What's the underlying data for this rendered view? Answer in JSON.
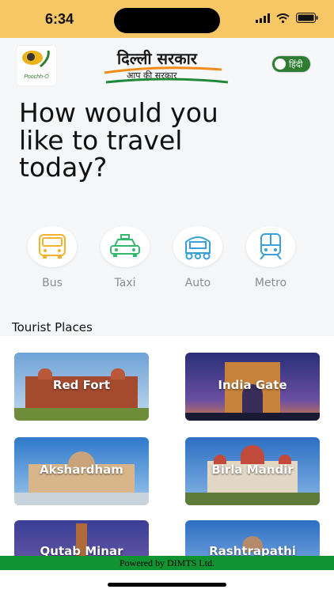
{
  "status_bar": {
    "time": "6:34"
  },
  "header": {
    "logo_caption": "Poochh-O",
    "govt_title": "दिल्ली सरकार",
    "govt_subtitle": "आप की सरकार",
    "language_toggle_label": "हिंदी"
  },
  "heading": "How would you like to travel today?",
  "modes": [
    {
      "label": "Bus",
      "icon": "bus-icon"
    },
    {
      "label": "Taxi",
      "icon": "taxi-icon"
    },
    {
      "label": "Auto",
      "icon": "auto-rickshaw-icon"
    },
    {
      "label": "Metro",
      "icon": "metro-icon"
    }
  ],
  "tourist_places": {
    "title": "Tourist Places",
    "items": [
      {
        "name": "Red Fort"
      },
      {
        "name": "India Gate"
      },
      {
        "name": "Akshardham"
      },
      {
        "name": "Birla Mandir"
      },
      {
        "name": "Qutab Minar"
      },
      {
        "name": "Rashtrapathi"
      }
    ]
  },
  "footer": {
    "text": "Powered by DIMTS Ltd."
  }
}
